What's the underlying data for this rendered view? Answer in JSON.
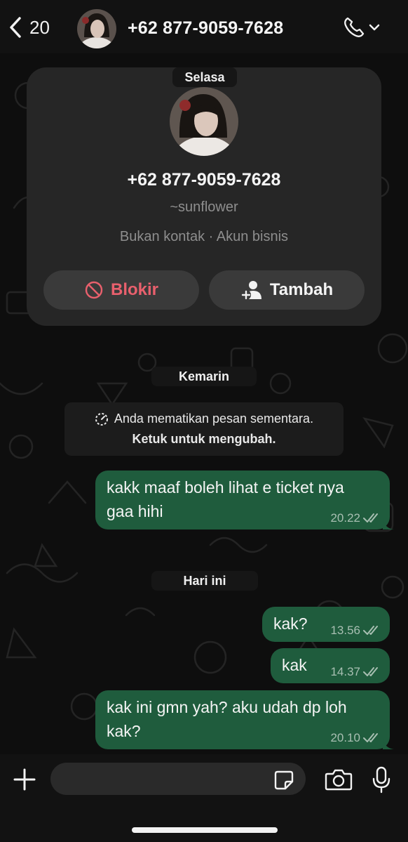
{
  "header": {
    "back_count": "20",
    "title": "+62 877-9059-7628"
  },
  "profile_card": {
    "day_label": "Selasa",
    "number": "+62 877-9059-7628",
    "name": "~sunflower",
    "meta": "Bukan kontak · Akun bisnis",
    "block_label": "Blokir",
    "add_label": "Tambah"
  },
  "separators": {
    "yesterday": "Kemarin",
    "today": "Hari ini"
  },
  "notice": {
    "line1": "Anda mematikan pesan sementara.",
    "line2": "Ketuk untuk mengubah."
  },
  "messages": [
    {
      "text_line1": "kakk maaf boleh lihat e ticket nya",
      "text_line2": "gaa hihi",
      "time": "20.22"
    },
    {
      "text": "kak?",
      "time": "13.56"
    },
    {
      "text": "kak",
      "time": "14.37"
    },
    {
      "text_line1": "kak ini gmn yah? aku udah dp loh",
      "text_line2": "kak?",
      "time": "20.10"
    }
  ],
  "composer": {
    "placeholder": ""
  },
  "colors": {
    "bubble_out": "#1f5c3d",
    "block_red": "#e9606d",
    "read_ticks": "#a8bfb2"
  },
  "icons": [
    "back-chevron-icon",
    "phone-icon",
    "chevron-down-icon",
    "block-icon",
    "add-contact-icon",
    "timer-icon",
    "double-check-icon",
    "plus-icon",
    "sticker-icon",
    "camera-icon",
    "mic-icon"
  ]
}
